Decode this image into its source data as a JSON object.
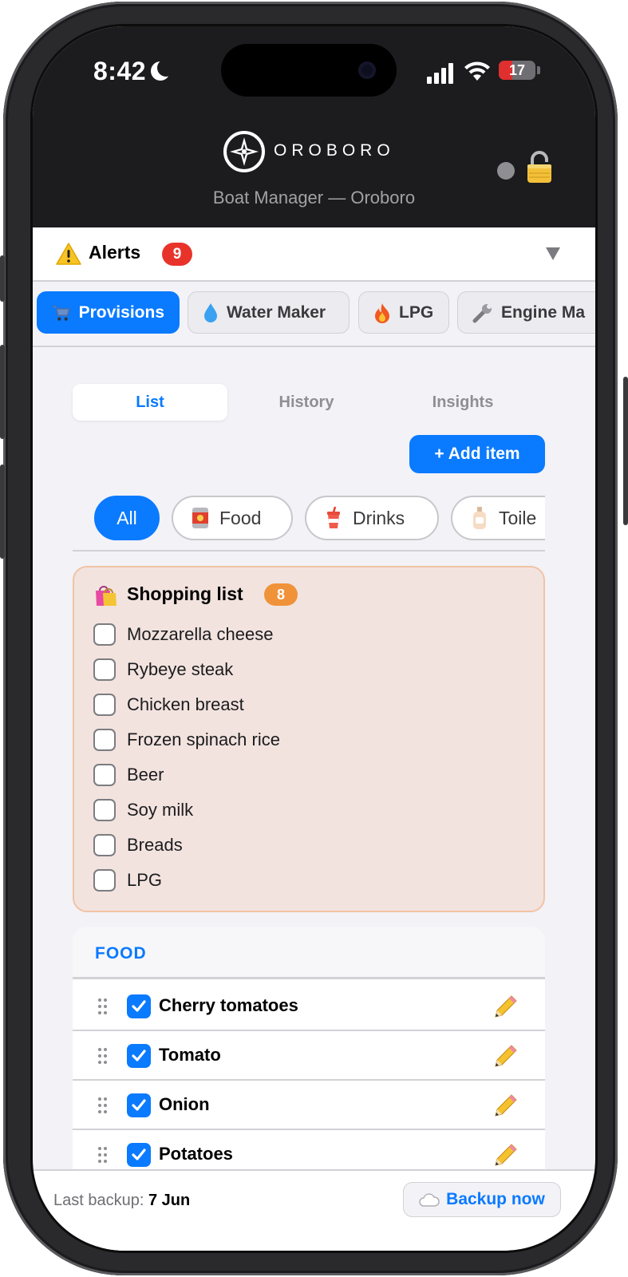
{
  "status_bar": {
    "time": "8:42",
    "battery": "17",
    "battery_fraction": 0.17
  },
  "header": {
    "brand": "OROBORO",
    "subtitle": "Boat Manager — Oroboro"
  },
  "alerts": {
    "label": "Alerts",
    "count": "9"
  },
  "modules": [
    {
      "label": "Provisions",
      "icon": "cart-icon"
    },
    {
      "label": "Water Maker",
      "icon": "water-drop-icon"
    },
    {
      "label": "LPG",
      "icon": "fire-icon"
    },
    {
      "label": "Engine Ma",
      "icon": "wrench-icon"
    }
  ],
  "segments": [
    "List",
    "History",
    "Insights"
  ],
  "add_item_label": "+ Add item",
  "categories": [
    {
      "label": "All"
    },
    {
      "label": "Food",
      "icon": "can-icon"
    },
    {
      "label": "Drinks",
      "icon": "cup-icon"
    },
    {
      "label": "Toile",
      "icon": "lotion-icon"
    }
  ],
  "shopping_list": {
    "title": "Shopping list",
    "count": "8",
    "items": [
      "Mozzarella cheese",
      "Rybeye steak",
      "Chicken breast",
      "Frozen spinach rice",
      "Beer",
      "Soy milk",
      "Breads",
      "LPG"
    ]
  },
  "food_section": {
    "title": "FOOD",
    "items": [
      "Cherry tomatoes",
      "Tomato",
      "Onion",
      "Potatoes"
    ]
  },
  "backup": {
    "label": "Last backup:",
    "date": "7 Jun",
    "button": "Backup now"
  },
  "colors": {
    "accent": "#0a7aff",
    "alert": "#e8332b",
    "shopping_badge": "#f0923a"
  }
}
